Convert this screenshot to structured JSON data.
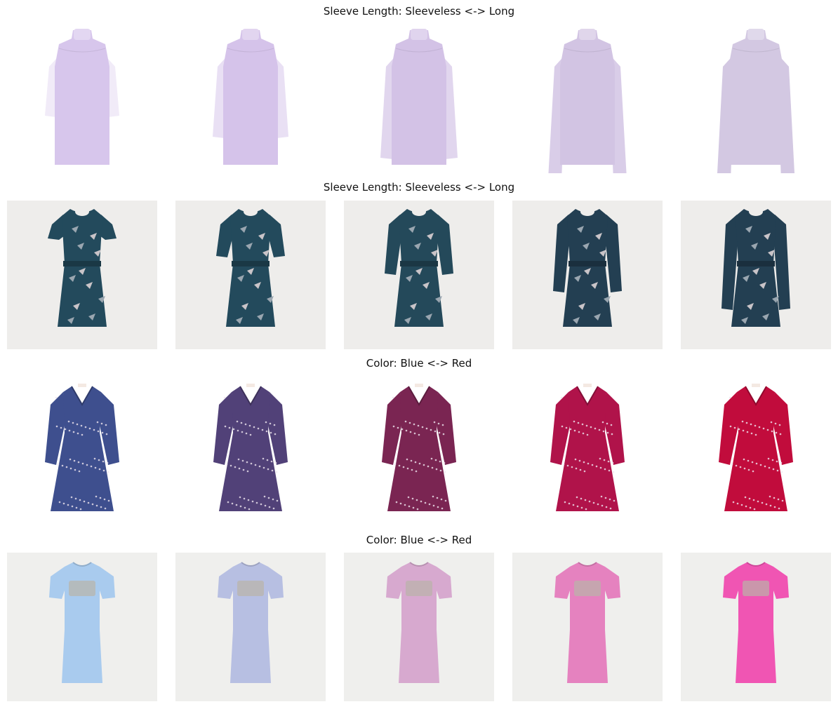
{
  "rows": [
    {
      "title": "Sleeve Length: Sleeveless <-> Long",
      "bg": "#ffffff",
      "style": "sweater",
      "colors": [
        "#d7c6ec",
        "#d5c3ea",
        "#d3c2e6",
        "#d2c4e3",
        "#d3c8e2"
      ],
      "sleeve": [
        0.0,
        0.25,
        0.5,
        0.75,
        1.0
      ]
    },
    {
      "title": "Sleeve Length: Sleeveless <-> Long",
      "bg": "#eeedeb",
      "style": "floral-dress",
      "colors": [
        "#234a5c",
        "#234a5c",
        "#24495a",
        "#233f52",
        "#233f52"
      ],
      "sleeve": [
        0.0,
        0.25,
        0.5,
        0.75,
        1.0
      ]
    },
    {
      "title": "Color: Blue <-> Red",
      "bg": "#ffffff",
      "style": "wrap-dress",
      "colors": [
        "#3e4f8e",
        "#514178",
        "#7a2552",
        "#b0134a",
        "#c10c3c"
      ],
      "sleeve": [
        0.7,
        0.7,
        0.7,
        0.7,
        0.7
      ]
    },
    {
      "title": "Color: Blue <-> Red",
      "bg": "#efefed",
      "style": "tee-dress",
      "colors": [
        "#a9cbee",
        "#b7bfe2",
        "#d7a9cf",
        "#e582bf",
        "#f055b3"
      ],
      "sleeve": [
        0.25,
        0.25,
        0.25,
        0.25,
        0.25
      ]
    }
  ]
}
